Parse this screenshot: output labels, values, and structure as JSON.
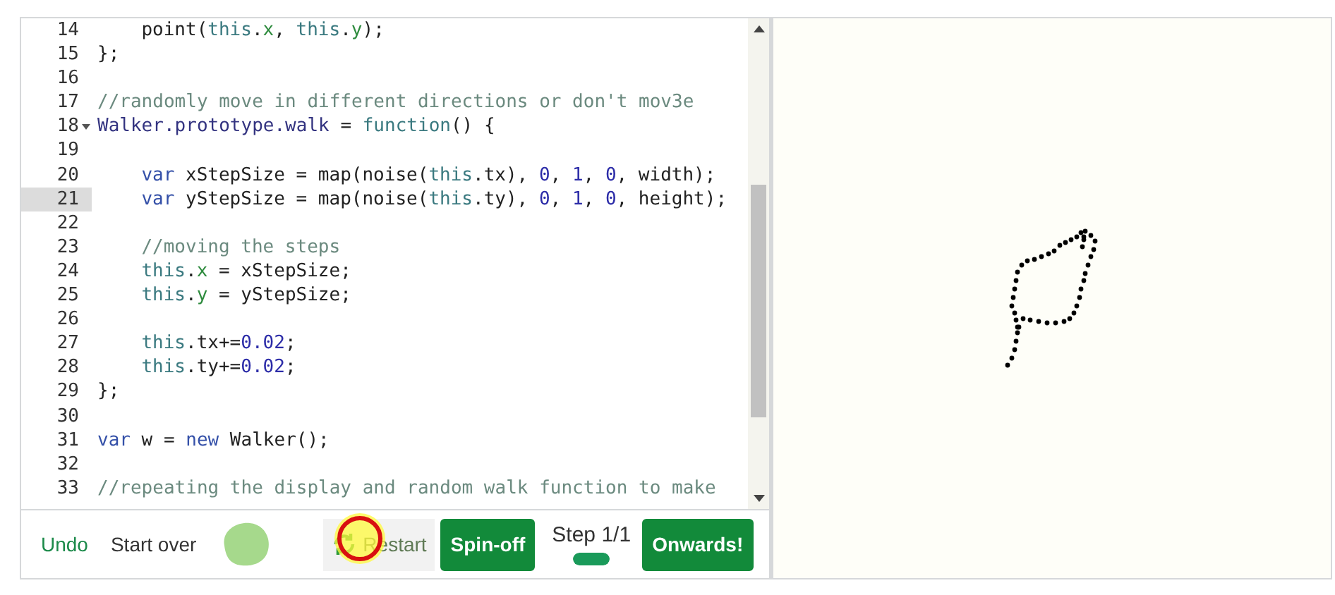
{
  "editor": {
    "lines": [
      {
        "number": "14",
        "active": false,
        "indent": true,
        "tokens": [
          {
            "kind": "plain",
            "text": "point("
          },
          {
            "kind": "this",
            "text": "this"
          },
          {
            "kind": "plain",
            "text": "."
          },
          {
            "kind": "prop",
            "text": "x"
          },
          {
            "kind": "plain",
            "text": ", "
          },
          {
            "kind": "this",
            "text": "this"
          },
          {
            "kind": "plain",
            "text": "."
          },
          {
            "kind": "prop",
            "text": "y"
          },
          {
            "kind": "plain",
            "text": ");"
          }
        ]
      },
      {
        "number": "15",
        "active": false,
        "indent": false,
        "tokens": [
          {
            "kind": "plain",
            "text": "};"
          }
        ]
      },
      {
        "number": "16",
        "active": false
      },
      {
        "number": "17",
        "active": false,
        "indent": false,
        "tokens": [
          {
            "kind": "comment",
            "text": "//randomly move in different directions or don't mov3e"
          }
        ]
      },
      {
        "number": "18",
        "active": false,
        "fold": true,
        "indent": false,
        "tokens": [
          {
            "kind": "ident",
            "text": "Walker.prototype.walk"
          },
          {
            "kind": "plain",
            "text": " = "
          },
          {
            "kind": "this",
            "text": "function"
          },
          {
            "kind": "plain",
            "text": "() {"
          }
        ]
      },
      {
        "number": "19",
        "active": false
      },
      {
        "number": "20",
        "active": false,
        "indent": true,
        "tokens": [
          {
            "kind": "keyword",
            "text": "var"
          },
          {
            "kind": "plain",
            "text": " xStepSize = map(noise("
          },
          {
            "kind": "this",
            "text": "this"
          },
          {
            "kind": "plain",
            "text": ".tx), "
          },
          {
            "kind": "number",
            "text": "0"
          },
          {
            "kind": "plain",
            "text": ", "
          },
          {
            "kind": "number",
            "text": "1"
          },
          {
            "kind": "plain",
            "text": ", "
          },
          {
            "kind": "number",
            "text": "0"
          },
          {
            "kind": "plain",
            "text": ", width);"
          }
        ]
      },
      {
        "number": "21",
        "active": true,
        "indent": true,
        "tokens": [
          {
            "kind": "keyword",
            "text": "var"
          },
          {
            "kind": "plain",
            "text": " yStepSize = map(noise("
          },
          {
            "kind": "this",
            "text": "this"
          },
          {
            "kind": "plain",
            "text": ".ty), "
          },
          {
            "kind": "number",
            "text": "0"
          },
          {
            "kind": "plain",
            "text": ", "
          },
          {
            "kind": "number",
            "text": "1"
          },
          {
            "kind": "plain",
            "text": ", "
          },
          {
            "kind": "number",
            "text": "0"
          },
          {
            "kind": "plain",
            "text": ", height);"
          }
        ]
      },
      {
        "number": "22",
        "active": false
      },
      {
        "number": "23",
        "active": false,
        "indent": true,
        "tokens": [
          {
            "kind": "comment",
            "text": "//moving the steps"
          }
        ]
      },
      {
        "number": "24",
        "active": false,
        "indent": true,
        "tokens": [
          {
            "kind": "this",
            "text": "this"
          },
          {
            "kind": "plain",
            "text": "."
          },
          {
            "kind": "prop",
            "text": "x"
          },
          {
            "kind": "plain",
            "text": " = xStepSize;"
          }
        ]
      },
      {
        "number": "25",
        "active": false,
        "indent": true,
        "tokens": [
          {
            "kind": "this",
            "text": "this"
          },
          {
            "kind": "plain",
            "text": "."
          },
          {
            "kind": "prop",
            "text": "y"
          },
          {
            "kind": "plain",
            "text": " = yStepSize;"
          }
        ]
      },
      {
        "number": "26",
        "active": false
      },
      {
        "number": "27",
        "active": false,
        "indent": true,
        "tokens": [
          {
            "kind": "this",
            "text": "this"
          },
          {
            "kind": "plain",
            "text": ".tx+="
          },
          {
            "kind": "number",
            "text": "0.02"
          },
          {
            "kind": "plain",
            "text": ";"
          }
        ]
      },
      {
        "number": "28",
        "active": false,
        "indent": true,
        "tokens": [
          {
            "kind": "this",
            "text": "this"
          },
          {
            "kind": "plain",
            "text": ".ty+="
          },
          {
            "kind": "number",
            "text": "0.02"
          },
          {
            "kind": "plain",
            "text": ";"
          }
        ]
      },
      {
        "number": "29",
        "active": false,
        "indent": false,
        "tokens": [
          {
            "kind": "plain",
            "text": "};"
          }
        ]
      },
      {
        "number": "30",
        "active": false
      },
      {
        "number": "31",
        "active": false,
        "indent": false,
        "tokens": [
          {
            "kind": "keyword",
            "text": "var"
          },
          {
            "kind": "plain",
            "text": " w = "
          },
          {
            "kind": "keyword",
            "text": "new"
          },
          {
            "kind": "plain",
            "text": " Walker();"
          }
        ]
      },
      {
        "number": "32",
        "active": false
      },
      {
        "number": "33",
        "active": false,
        "indent": false,
        "tokens": [
          {
            "kind": "comment",
            "text": "//repeating the display and random walk function to make"
          }
        ]
      }
    ]
  },
  "toolbar": {
    "undo": "Undo",
    "start_over": "Start over",
    "restart": {
      "label": "Restart",
      "disabled": true
    },
    "spin_off": "Spin-off",
    "step": {
      "label": "Step 1/1",
      "level": 1
    },
    "onwards": "Onwards!"
  }
}
